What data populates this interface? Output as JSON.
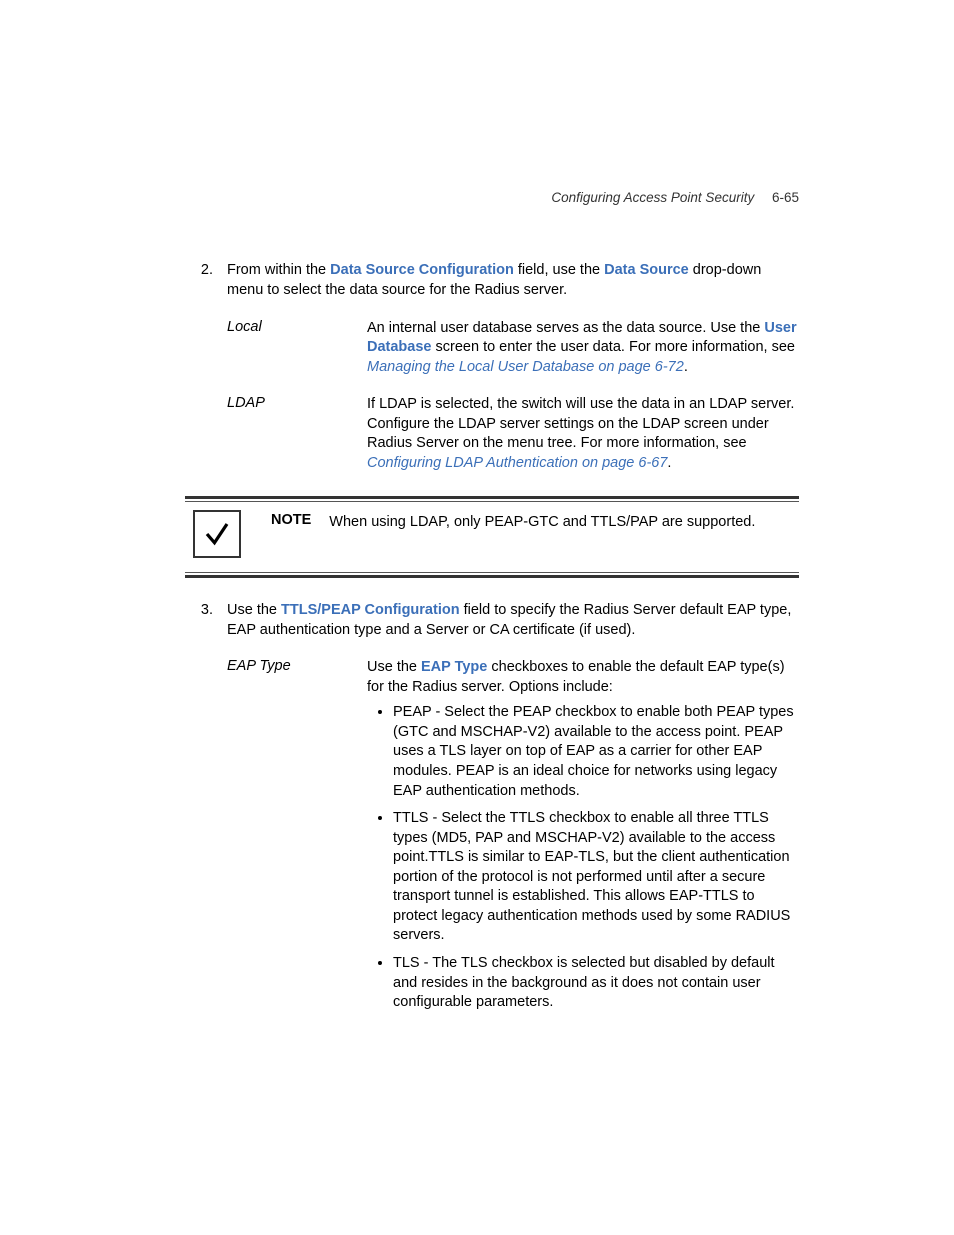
{
  "header": {
    "title": "Configuring Access Point Security",
    "page": "6-65"
  },
  "step2": {
    "number": "2.",
    "pre1": "From within the ",
    "bold1": "Data Source Configuration",
    "mid1": " field, use the ",
    "bold2": "Data Source",
    "post1": " drop-down menu to select the data source for the Radius server."
  },
  "def1": {
    "rows": [
      {
        "term": "Local",
        "pre": "An internal user database serves as the data source. Use the ",
        "bold": "User Database",
        "mid": " screen to enter the user data. For more information, see ",
        "link": "Managing the Local User Database on page 6-72",
        "post": "."
      },
      {
        "term": "LDAP",
        "pre": "If LDAP is selected, the switch will use the data in an LDAP server. Configure the LDAP server settings on the LDAP screen under Radius Server on the menu tree. For more information, see ",
        "bold": "",
        "mid": "",
        "link": "Configuring LDAP Authentication on page 6-67",
        "post": "."
      }
    ]
  },
  "note": {
    "label": "NOTE",
    "text": "When using LDAP, only PEAP-GTC and TTLS/PAP are supported."
  },
  "step3": {
    "number": "3.",
    "pre1": "Use the ",
    "bold1": "TTLS/PEAP Configuration",
    "post1": " field to specify the Radius Server default EAP type, EAP authentication type and a Server or CA certificate (if used)."
  },
  "def2": {
    "term": "EAP Type",
    "pre": "Use the ",
    "bold": "EAP Type",
    "post": " checkboxes to enable the default EAP type(s) for the Radius server. Options include:",
    "bullets": [
      "PEAP - Select the PEAP checkbox to enable both PEAP types (GTC and MSCHAP-V2) available to the access point. PEAP uses a TLS layer on top of EAP as a carrier for other EAP modules. PEAP is an ideal choice for networks using legacy EAP authentication methods.",
      "TTLS - Select the TTLS checkbox to enable all three TTLS types (MD5, PAP and MSCHAP-V2) available to the access point.TTLS is similar to EAP-TLS, but the client authentication portion of the protocol is not performed until after a secure transport tunnel is established. This allows EAP-TTLS to protect legacy authentication methods used by some RADIUS servers.",
      "TLS - The TLS checkbox is selected but disabled by default and resides in the background as it does not contain user configurable parameters."
    ]
  }
}
